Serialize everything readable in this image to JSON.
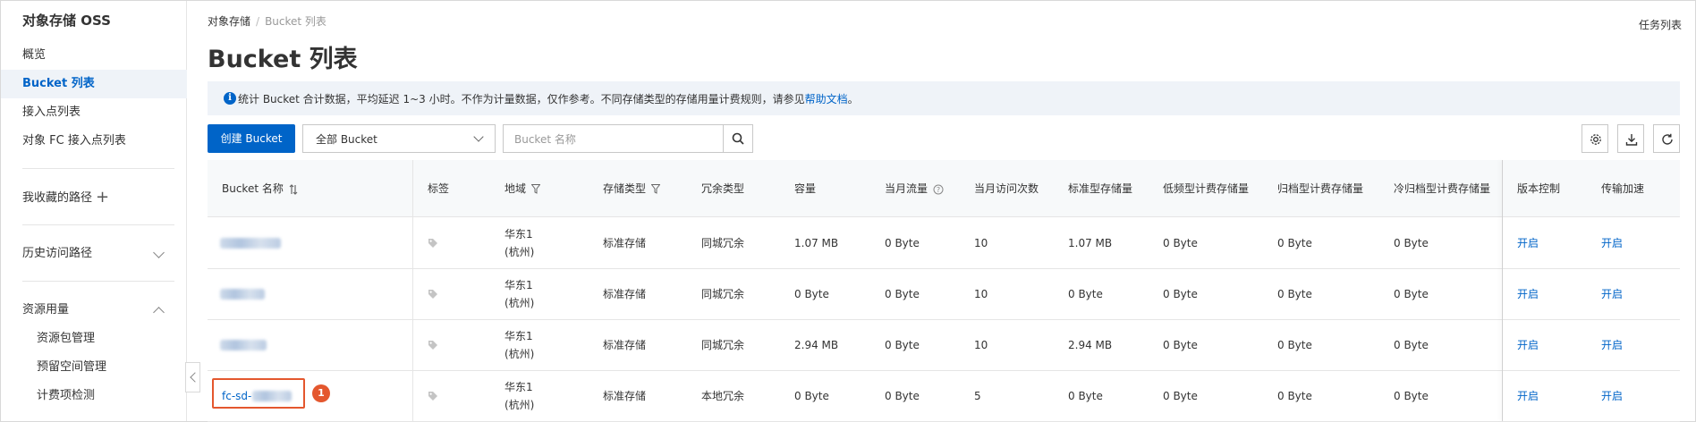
{
  "sidebar": {
    "title": "对象存储 OSS",
    "items": [
      {
        "label": "概览"
      },
      {
        "label": "Bucket 列表"
      },
      {
        "label": "接入点列表"
      },
      {
        "label": "对象 FC 接入点列表"
      }
    ],
    "favorites_label": "我收藏的路径",
    "history_label": "历史访问路径",
    "resource_label": "资源用量",
    "resource_items": [
      {
        "label": "资源包管理"
      },
      {
        "label": "预留空间管理"
      },
      {
        "label": "计费项检测"
      }
    ]
  },
  "breadcrumb": {
    "root": "对象存储",
    "separator": "/",
    "current": "Bucket 列表"
  },
  "task_center": "任务列表",
  "page_title": "Bucket 列表",
  "notice": {
    "text": "统计 Bucket 合计数据，平均延迟 1~3 小时。不作为计量数据，仅作参考。不同存储类型的存储用量计费规则，请参见",
    "link": "帮助文档",
    "suffix": "。"
  },
  "toolbar": {
    "create_label": "创建 Bucket",
    "select_value": "全部 Bucket",
    "search_placeholder": "Bucket 名称"
  },
  "table": {
    "headers": {
      "name": "Bucket 名称",
      "tags": "标签",
      "region": "地域",
      "storage_class": "存储类型",
      "redundancy": "冗余类型",
      "capacity": "容量",
      "traffic": "当月流量",
      "requests": "当月访问次数",
      "standard": "标准型存储量",
      "ia": "低频型计费存储量",
      "archive": "归档型计费存储量",
      "cold": "冷归档型计费存储量",
      "versioning": "版本控制",
      "acceleration": "传输加速"
    },
    "rows": [
      {
        "name": "",
        "region_line1": "华东1",
        "region_line2": "(杭州)",
        "storage_class": "标准存储",
        "redundancy": "同城冗余",
        "capacity": "1.07 MB",
        "traffic": "0 Byte",
        "requests": "10",
        "standard": "1.07 MB",
        "ia": "0 Byte",
        "archive": "0 Byte",
        "cold": "0 Byte",
        "versioning": "开启",
        "acceleration": "开启"
      },
      {
        "name": "",
        "region_line1": "华东1",
        "region_line2": "(杭州)",
        "storage_class": "标准存储",
        "redundancy": "同城冗余",
        "capacity": "0 Byte",
        "traffic": "0 Byte",
        "requests": "10",
        "standard": "0 Byte",
        "ia": "0 Byte",
        "archive": "0 Byte",
        "cold": "0 Byte",
        "versioning": "开启",
        "acceleration": "开启"
      },
      {
        "name": "",
        "region_line1": "华东1",
        "region_line2": "(杭州)",
        "storage_class": "标准存储",
        "redundancy": "同城冗余",
        "capacity": "2.94 MB",
        "traffic": "0 Byte",
        "requests": "10",
        "standard": "2.94 MB",
        "ia": "0 Byte",
        "archive": "0 Byte",
        "cold": "0 Byte",
        "versioning": "开启",
        "acceleration": "开启"
      },
      {
        "name": "fc-sd-",
        "region_line1": "华东1",
        "region_line2": "(杭州)",
        "storage_class": "标准存储",
        "redundancy": "本地冗余",
        "capacity": "0 Byte",
        "traffic": "0 Byte",
        "requests": "5",
        "standard": "0 Byte",
        "ia": "0 Byte",
        "archive": "0 Byte",
        "cold": "0 Byte",
        "versioning": "开启",
        "acceleration": "开启"
      }
    ]
  },
  "annotation": {
    "badge": "1"
  },
  "colors": {
    "accent": "#0064c8",
    "callout": "#e4572e",
    "notice_bg": "#eff3f8"
  }
}
